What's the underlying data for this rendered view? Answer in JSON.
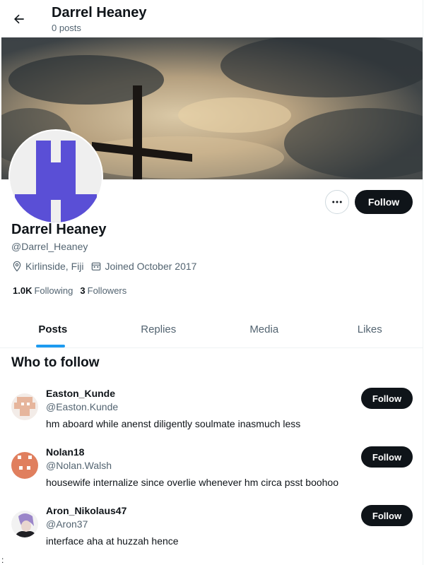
{
  "header": {
    "title": "Darrel Heaney",
    "subtitle": "0 posts",
    "back_icon": "arrow-left-icon"
  },
  "profile": {
    "display_name": "Darrel Heaney",
    "handle": "@Darrel_Heaney",
    "location": "Kirlinside, Fiji",
    "joined": "Joined October 2017",
    "following_count": "1.0K",
    "following_label": "Following",
    "followers_count": "3",
    "followers_label": "Followers",
    "follow_label": "Follow",
    "more_icon": "more-horizontal-icon",
    "avatar_color": "#5b4fd8",
    "banner_icon": "cross-sky-photo"
  },
  "tabs": [
    {
      "label": "Posts",
      "active": true
    },
    {
      "label": "Replies",
      "active": false
    },
    {
      "label": "Media",
      "active": false
    },
    {
      "label": "Likes",
      "active": false
    }
  ],
  "who_to_follow": {
    "title": "Who to follow",
    "users": [
      {
        "name": "Easton_Kunde",
        "handle": "@Easton.Kunde",
        "bio": "hm aboard while anenst diligently soulmate inasmuch less",
        "follow_label": "Follow",
        "avatar_color": "#e8b49a"
      },
      {
        "name": "Nolan18",
        "handle": "@Nolan.Walsh",
        "bio": "housewife internalize since overlie whenever hm circa psst boohoo",
        "follow_label": "Follow",
        "avatar_color": "#e07f5e"
      },
      {
        "name": "Aron_Nikolaus47",
        "handle": "@Aron37",
        "bio": "interface aha at huzzah hence",
        "follow_label": "Follow",
        "avatar_color": "#9b86c9"
      }
    ]
  },
  "stray_text": ":",
  "colors": {
    "accent": "#1d9bf0",
    "text": "#0f1419",
    "muted": "#536471",
    "button": "#0f1419"
  }
}
